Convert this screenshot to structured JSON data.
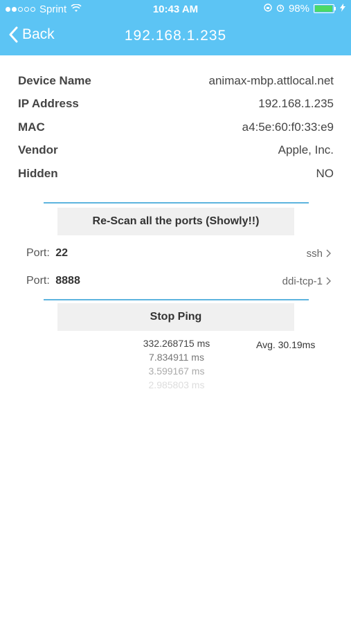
{
  "status": {
    "carrier": "Sprint",
    "time": "10:43 AM",
    "battery": "98%",
    "battery_level": 0.98,
    "icons": [
      "wifi-icon",
      "rotation-lock-icon",
      "alarm-icon",
      "battery-icon",
      "charging-icon"
    ]
  },
  "nav": {
    "back_label": "Back",
    "title": "192.168.1.235"
  },
  "device_info": [
    {
      "label": "Device Name",
      "value": "animax-mbp.attlocal.net"
    },
    {
      "label": "IP Address",
      "value": "192.168.1.235"
    },
    {
      "label": "MAC",
      "value": "a4:5e:60:f0:33:e9"
    },
    {
      "label": "Vendor",
      "value": "Apple, Inc."
    },
    {
      "label": "Hidden",
      "value": "NO"
    }
  ],
  "rescan_button": "Re-Scan all the ports (Showly!!)",
  "ports": [
    {
      "label": "Port:",
      "number": "22",
      "service": "ssh"
    },
    {
      "label": "Port:",
      "number": "8888",
      "service": "ddi-tcp-1"
    }
  ],
  "stop_ping_button": "Stop Ping",
  "ping": {
    "results": [
      "332.268715 ms",
      "7.834911 ms",
      "3.599167 ms",
      "2.985803 ms"
    ],
    "average": "Avg. 30.19ms"
  },
  "colors": {
    "header": "#5cc4f4",
    "divider": "#5cb4de",
    "button_bg": "#f0f0f0"
  }
}
